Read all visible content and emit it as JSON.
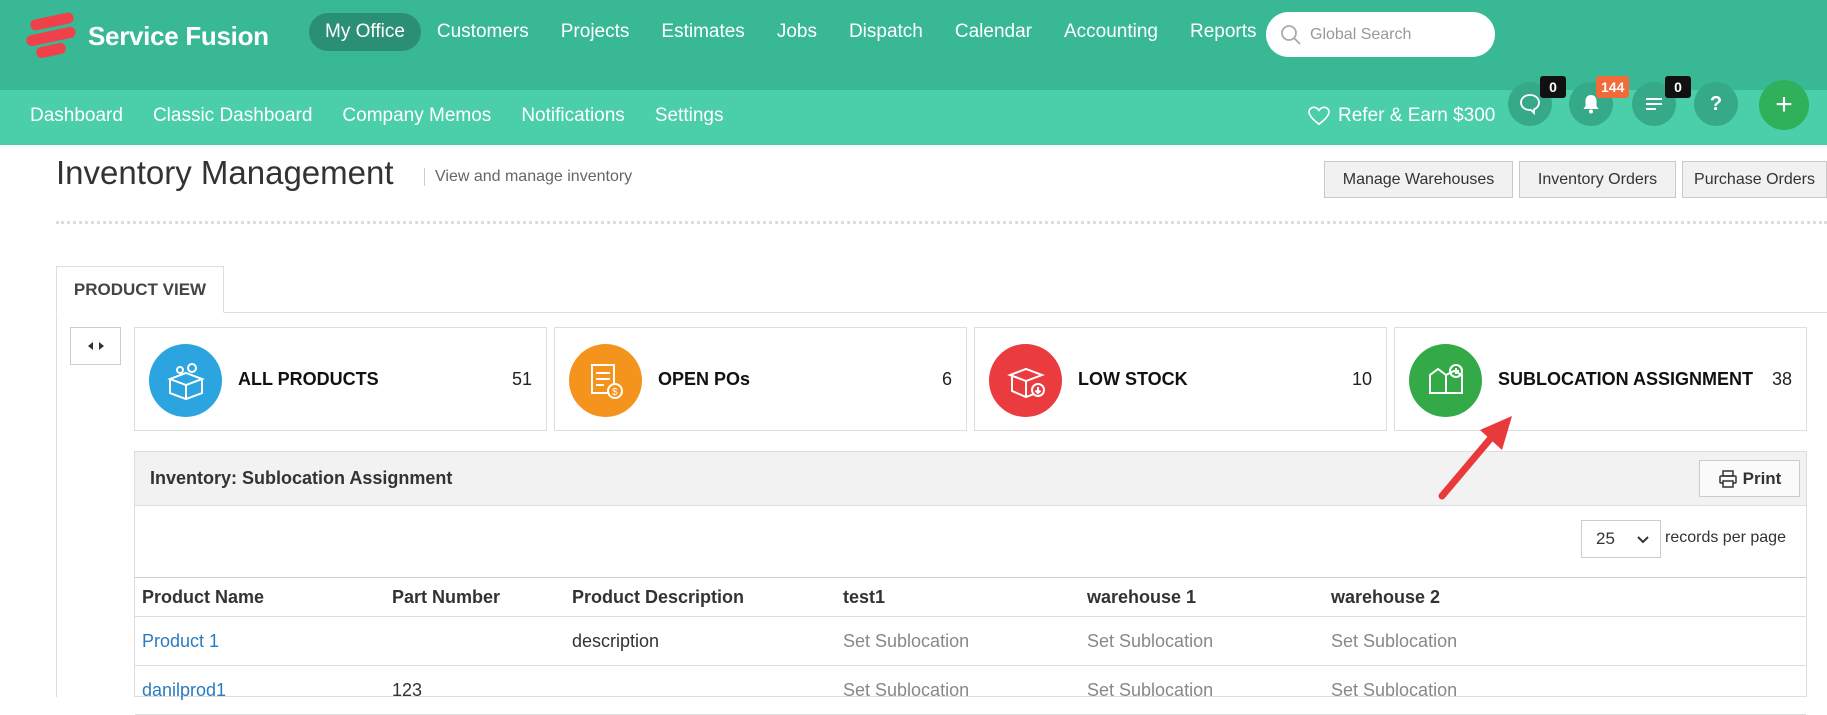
{
  "app": {
    "brand": "Service Fusion",
    "brand_color": "#39b895",
    "accent_red": "#f0404a"
  },
  "main_nav": {
    "items": [
      {
        "label": "My Office",
        "active": true
      },
      {
        "label": "Customers"
      },
      {
        "label": "Projects"
      },
      {
        "label": "Estimates"
      },
      {
        "label": "Jobs"
      },
      {
        "label": "Dispatch"
      },
      {
        "label": "Calendar"
      },
      {
        "label": "Accounting"
      },
      {
        "label": "Reports"
      }
    ],
    "search_placeholder": "Global Search"
  },
  "sub_nav": {
    "items": [
      "Dashboard",
      "Classic Dashboard",
      "Company Memos",
      "Notifications",
      "Settings"
    ],
    "refer": "Refer & Earn $300",
    "badges": {
      "chat": "0",
      "notifications": "144",
      "tasks": "0"
    },
    "help": "?",
    "add": "+"
  },
  "page": {
    "title": "Inventory Management",
    "subtitle": "View and manage inventory",
    "buttons": [
      "Manage Warehouses",
      "Inventory Orders",
      "Purchase Orders"
    ],
    "tab": "PRODUCT VIEW"
  },
  "cards": [
    {
      "label": "ALL PRODUCTS",
      "count": "51",
      "color": "#2ba4df",
      "icon": "box-gear-icon"
    },
    {
      "label": "OPEN POs",
      "count": "6",
      "color": "#f5941c",
      "icon": "purchase-order-icon"
    },
    {
      "label": "LOW STOCK",
      "count": "10",
      "color": "#ea3b3f",
      "icon": "open-box-down-icon"
    },
    {
      "label": "SUBLOCATION ASSIGNMENT",
      "count": "38",
      "color": "#33aa47",
      "icon": "location-add-icon"
    }
  ],
  "panel": {
    "title": "Inventory: Sublocation Assignment",
    "print": "Print",
    "records_per_page": "25",
    "records_label": "records per page",
    "columns": [
      "Product Name",
      "Part Number",
      "Product Description",
      "test1",
      "warehouse 1",
      "warehouse 2"
    ],
    "rows": [
      [
        "Product 1",
        "",
        "description",
        "Set Sublocation",
        "Set Sublocation",
        "Set Sublocation"
      ],
      [
        "danilprod1",
        "123",
        "",
        "Set Sublocation",
        "Set Sublocation",
        "Set Sublocation"
      ]
    ]
  }
}
